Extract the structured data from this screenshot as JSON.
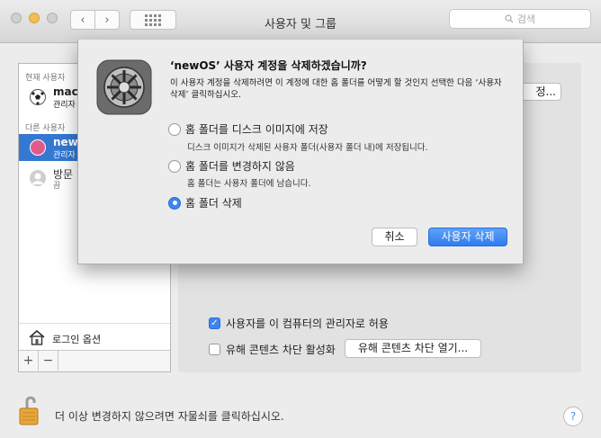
{
  "window": {
    "title": "사용자 및 그룹",
    "search_placeholder": "검색"
  },
  "sidebar": {
    "current_users_label": "현재 사용자",
    "other_users_label": "다른 사용자",
    "users": [
      {
        "name": "mac",
        "role": "관리자"
      },
      {
        "name": "new",
        "role": "관리자"
      },
      {
        "name": "방문",
        "role": "끔"
      }
    ],
    "login_options_label": "로그인 옵션",
    "add_label": "+",
    "remove_label": "−"
  },
  "main": {
    "edge_button_label": "정...",
    "admin_checkbox_label": "사용자를 이 컴퓨터의 관리자로 허용",
    "admin_checked": true,
    "parental_checkbox_label": "유해 콘텐츠 차단 활성화",
    "parental_checked": false,
    "parental_button_label": "유해 콘텐츠 차단 열기..."
  },
  "footer": {
    "lock_text": "더 이상 변경하지 않으려면 자물쇠를 클릭하십시오.",
    "help_label": "?"
  },
  "dialog": {
    "title": "‘newOS’ 사용자 계정을 삭제하겠습니까?",
    "description": "이 사용자 계정을 삭제하려면 이 계정에 대한 홈 폴더를 어떻게 할 것인지 선택한 다음 ‘사용자 삭제’ 클릭하십시오.",
    "options": [
      {
        "label": "홈 폴더를 디스크 이미지에 저장",
        "sub": "디스크 이미지가 삭제된 사용자 폴더(사용자 폴더 내)에 저장됩니다.",
        "selected": false
      },
      {
        "label": "홈 폴더를 변경하지 않음",
        "sub": "홈 폴더는 사용자 폴더에 남습니다.",
        "selected": false
      },
      {
        "label": "홈 폴더 삭제",
        "sub": "",
        "selected": true
      }
    ],
    "cancel_label": "취소",
    "confirm_label": "사용자 삭제"
  },
  "colors": {
    "accent": "#3478d2",
    "primary_button": "#2f7cf0"
  }
}
